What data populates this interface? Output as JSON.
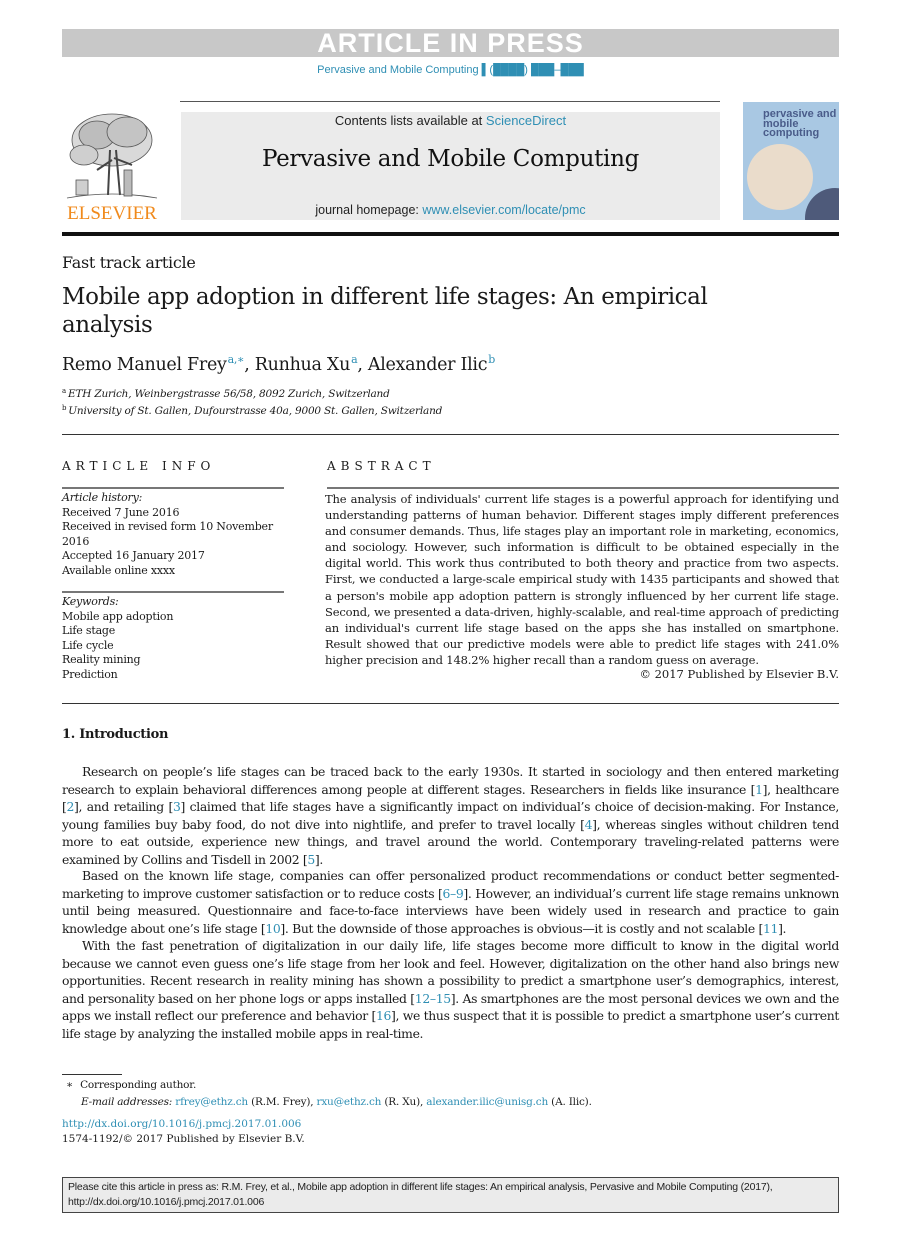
{
  "banner": {
    "text": "ARTICLE IN PRESS"
  },
  "journal_ref": "Pervasive and Mobile Computing ▌(████) ███–███",
  "masthead": {
    "contents_prefix": "Contents lists available at ",
    "contents_link": "ScienceDirect",
    "journal_title": "Pervasive and Mobile Computing",
    "homepage_prefix": "journal homepage: ",
    "homepage_link": "www.elsevier.com/locate/pmc",
    "publisher_logo_text": "ELSEVIER",
    "cover_title": "pervasive and mobile computing"
  },
  "colors": {
    "link": "#2f8fb4",
    "elsevier_orange": "#f08a1c",
    "banner_gray": "#c8c8c8",
    "masthead_bg": "#ebebeb"
  },
  "article": {
    "type": "Fast track article",
    "title": "Mobile app adoption in different life stages: An empirical analysis",
    "authors": [
      {
        "name": "Remo Manuel Frey",
        "sup": "a,∗"
      },
      {
        "name": "Runhua Xu",
        "sup": "a"
      },
      {
        "name": "Alexander Ilic",
        "sup": "b"
      }
    ],
    "affiliations": [
      {
        "mark": "a",
        "text": "ETH Zurich, Weinbergstrasse 56/58, 8092 Zurich, Switzerland"
      },
      {
        "mark": "b",
        "text": "University of St. Gallen, Dufourstrasse 40a, 9000 St. Gallen, Switzerland"
      }
    ]
  },
  "article_info": {
    "heading": "ARTICLE INFO",
    "history_label": "Article history:",
    "history": [
      "Received 7 June 2016",
      "Received in revised form 10 November 2016",
      "Accepted 16 January 2017",
      "Available online xxxx"
    ],
    "keywords_label": "Keywords:",
    "keywords": [
      "Mobile app adoption",
      "Life stage",
      "Life cycle",
      "Reality mining",
      "Prediction"
    ]
  },
  "abstract": {
    "heading": "ABSTRACT",
    "text": "The analysis of individuals' current life stages is a powerful approach for identifying und understanding patterns of human behavior. Different stages imply different preferences and consumer demands. Thus, life stages play an important role in marketing, economics, and sociology. However, such information is difficult to be obtained especially in the digital world. This work thus contributed to both theory and practice from two aspects. First, we conducted a large-scale empirical study with 1435 participants and showed that a person's mobile app adoption pattern is strongly influenced by her current life stage. Second, we presented a data-driven, highly-scalable, and real-time approach of predicting an individual's current life stage based on the apps she has installed on smartphone. Result showed that our predictive models were able to predict life stages with 241.0% higher precision and 148.2% higher recall than a random guess on average.",
    "copyright": "© 2017 Published by Elsevier B.V."
  },
  "introduction": {
    "heading": "1.  Introduction",
    "paragraphs": [
      [
        {
          "t": "Research on people’s life stages can be traced back to the early 1930s. It started in sociology and then entered marketing research to explain behavioral differences among people at different stages. Researchers in fields like insurance ["
        },
        {
          "ref": "1"
        },
        {
          "t": "], healthcare ["
        },
        {
          "ref": "2"
        },
        {
          "t": "], and retailing ["
        },
        {
          "ref": "3"
        },
        {
          "t": "] claimed that life stages have a significantly impact on individual’s choice of decision-making. For Instance, young families buy baby food, do not dive into nightlife, and prefer to travel locally ["
        },
        {
          "ref": "4"
        },
        {
          "t": "], whereas singles without children tend more to eat outside, experience new things, and travel around the world. Contemporary traveling-related patterns were examined by Collins and Tisdell in 2002 ["
        },
        {
          "ref": "5"
        },
        {
          "t": "]."
        }
      ],
      [
        {
          "t": "Based on the known life stage, companies can offer personalized product recommendations or conduct better segmented-marketing to improve customer satisfaction or to reduce costs ["
        },
        {
          "ref": "6–9"
        },
        {
          "t": "]. However, an individual’s current life stage remains unknown until being measured. Questionnaire and face-to-face interviews have been widely used in research and practice to gain knowledge about one’s life stage ["
        },
        {
          "ref": "10"
        },
        {
          "t": "]. But the downside of those approaches is obvious—it is costly and not scalable ["
        },
        {
          "ref": "11"
        },
        {
          "t": "]."
        }
      ],
      [
        {
          "t": "With the fast penetration of digitalization in our daily life, life stages become more difficult to know in the digital world because we cannot even guess one’s life stage from her look and feel. However, digitalization on the other hand also brings new opportunities. Recent research in reality mining has shown a possibility to predict a smartphone user’s demographics, interest, and personality based on her phone logs or apps installed ["
        },
        {
          "ref": "12–15"
        },
        {
          "t": "]. As smartphones are the most personal devices we own and the apps we install reflect our preference and behavior ["
        },
        {
          "ref": "16"
        },
        {
          "t": "], we thus suspect that it is possible to predict a smartphone user’s current life stage by analyzing the installed mobile apps in real-time."
        }
      ]
    ]
  },
  "footnotes": {
    "corresponding_mark": "∗",
    "corresponding_text": "Corresponding author.",
    "email_label": "E-mail addresses:",
    "emails": [
      {
        "address": "rfrey@ethz.ch",
        "owner": "(R.M. Frey)"
      },
      {
        "address": "rxu@ethz.ch",
        "owner": "(R. Xu)"
      },
      {
        "address": "alexander.ilic@unisg.ch",
        "owner": "(A. Ilic)."
      }
    ],
    "doi": "http://dx.doi.org/10.1016/j.pmcj.2017.01.006",
    "issn": "1574-1192/© 2017 Published by Elsevier B.V."
  },
  "citation_box": {
    "text": "Please cite this article in press as: R.M. Frey, et al., Mobile app adoption in different life stages: An empirical analysis, Pervasive and Mobile Computing (2017), http://dx.doi.org/10.1016/j.pmcj.2017.01.006"
  }
}
